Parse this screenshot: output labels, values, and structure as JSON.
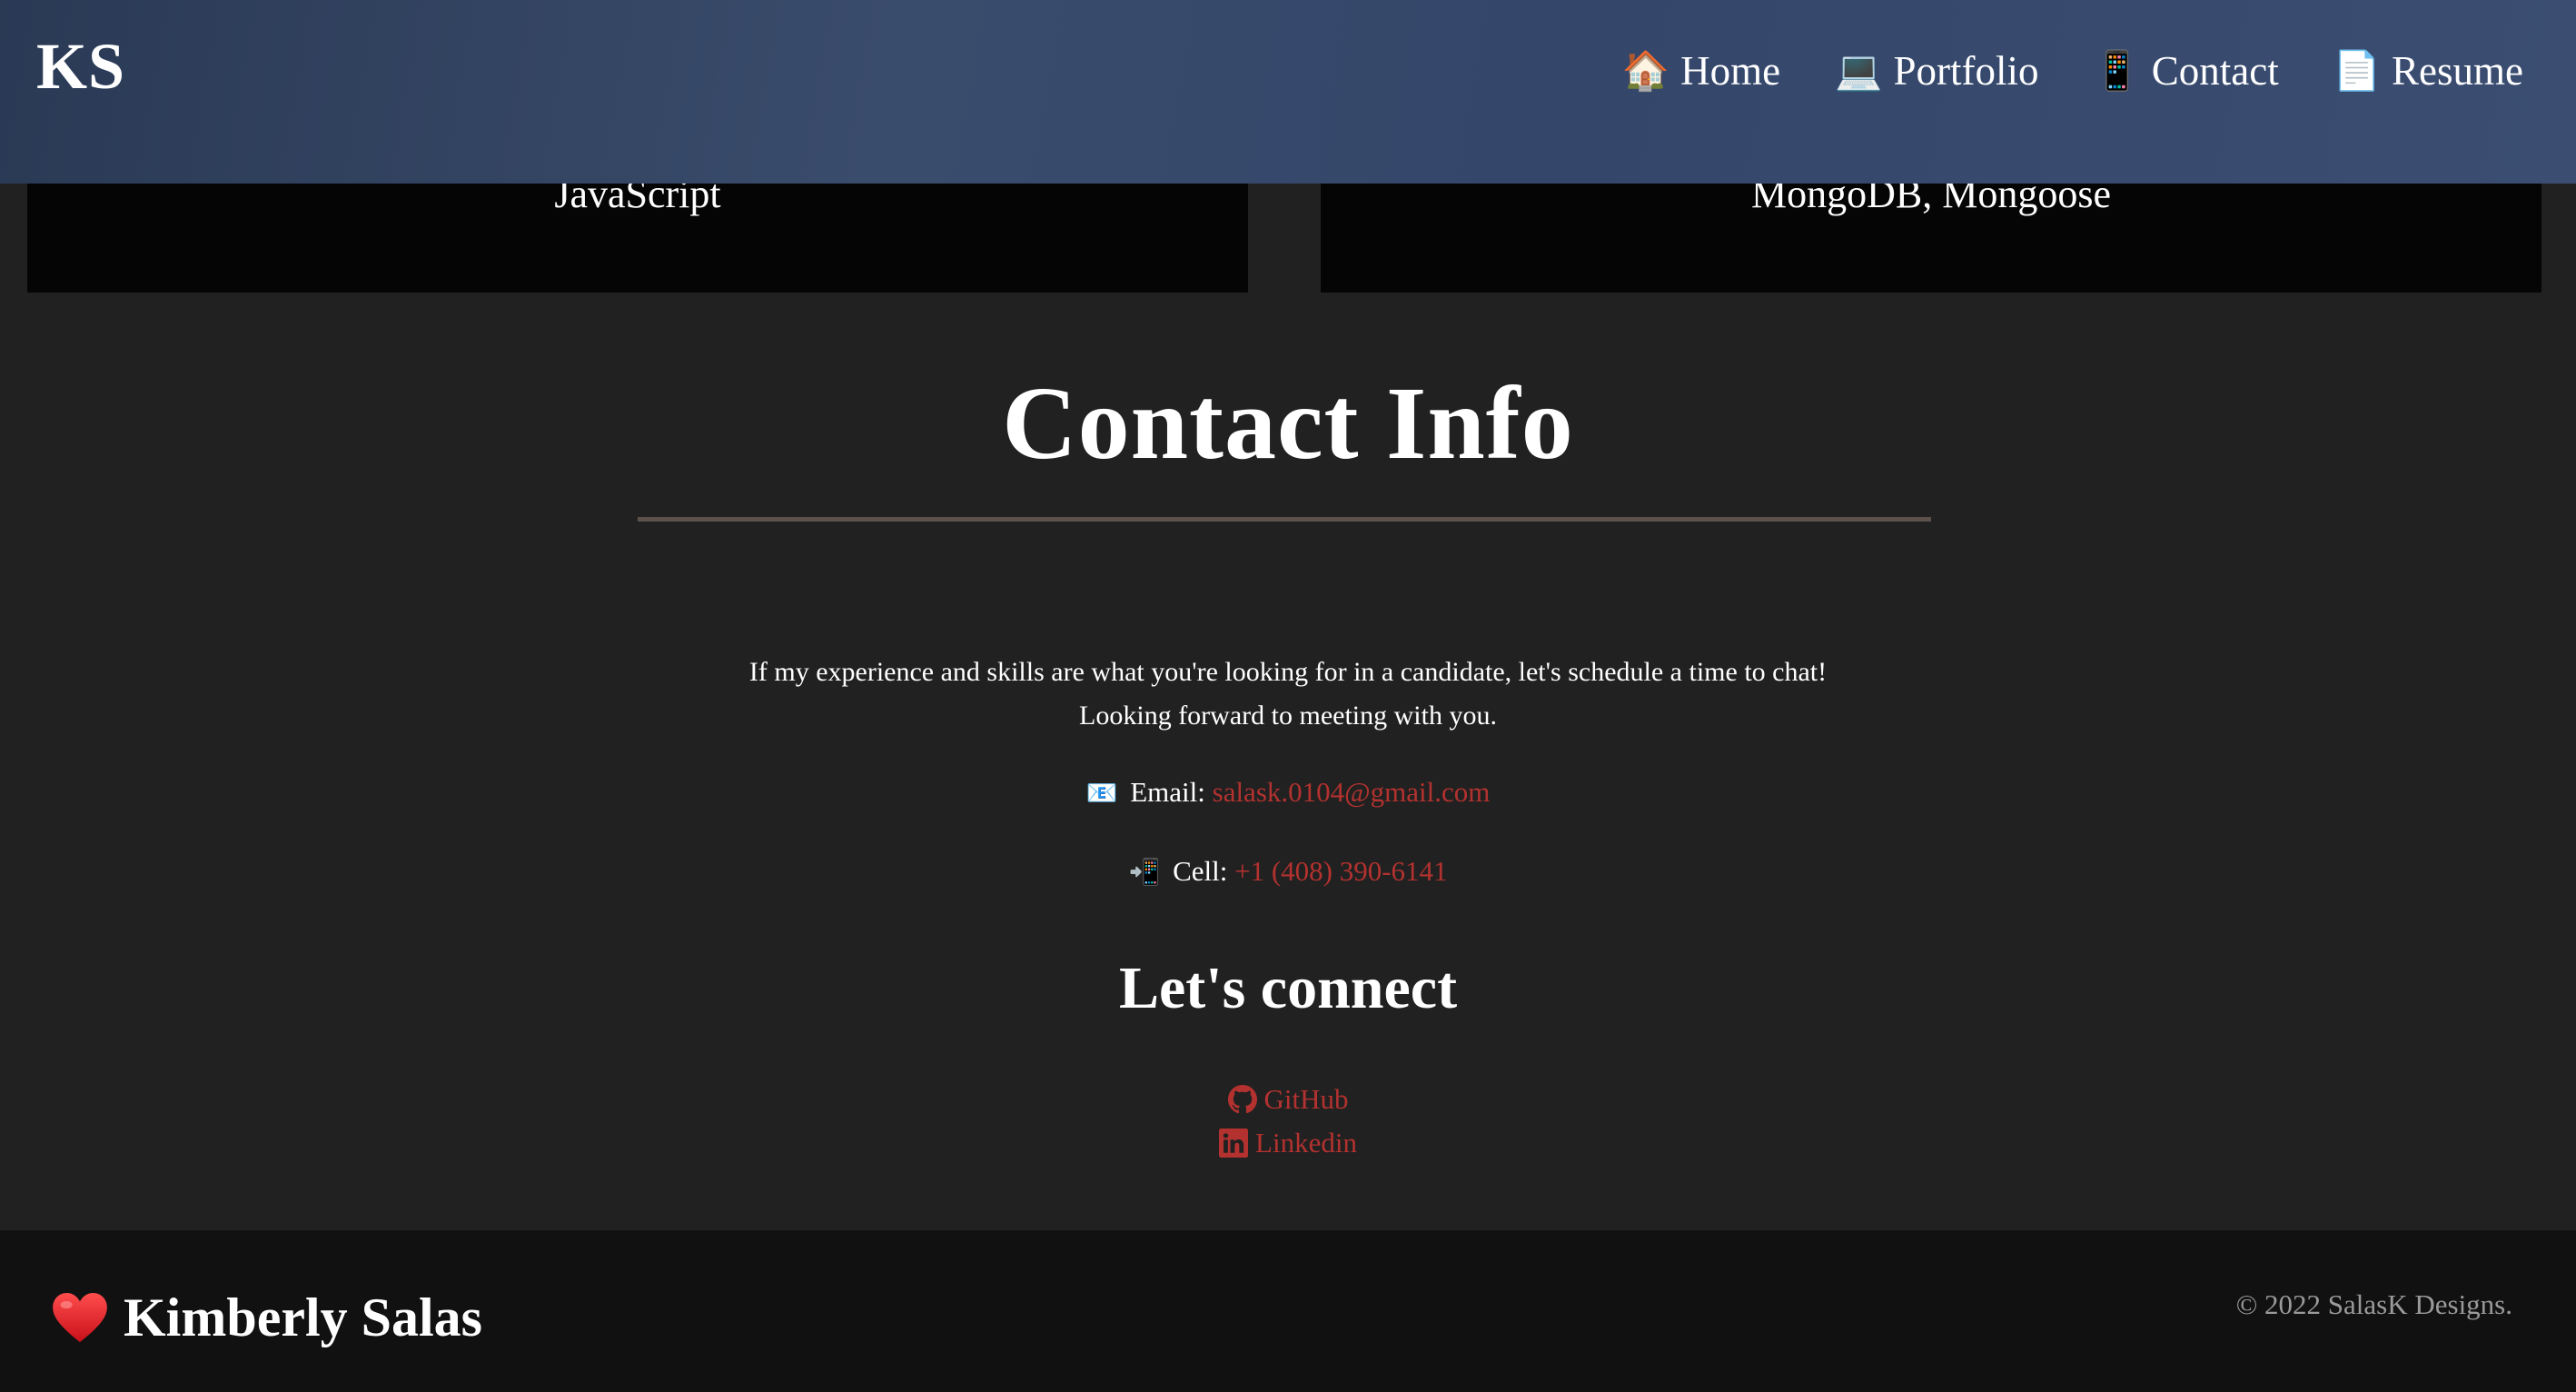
{
  "header": {
    "logo": "KS",
    "nav": [
      {
        "icon": "🏠",
        "label": "Home"
      },
      {
        "icon": "💻",
        "label": "Portfolio"
      },
      {
        "icon": "📱",
        "label": "Contact"
      },
      {
        "icon": "📄",
        "label": "Resume"
      }
    ]
  },
  "skills": {
    "left": "JavaScript",
    "right": "MongoDB, Mongoose"
  },
  "contact": {
    "title": "Contact Info",
    "intro_line1": "If my experience and skills are what you're looking for in a candidate, let's schedule a time to chat!",
    "intro_line2": "Looking forward to meeting with you.",
    "email_icon": "📧",
    "email_label": "Email:",
    "email_value": "salask.0104@gmail.com",
    "cell_icon": "📲",
    "cell_label": "Cell:",
    "cell_value": "+1 (408) 390-6141",
    "connect_title": "Let's connect",
    "github_label": "GitHub",
    "linkedin_label": "Linkedin"
  },
  "footer": {
    "name": "Kimberly Salas",
    "copyright": "© 2022 SalasK Designs."
  },
  "colors": {
    "header_bg": "#34466a",
    "page_bg": "#212121",
    "card_bg": "#050505",
    "link": "#b3322f",
    "footer_bg": "#111111",
    "divider": "#5c514c"
  }
}
